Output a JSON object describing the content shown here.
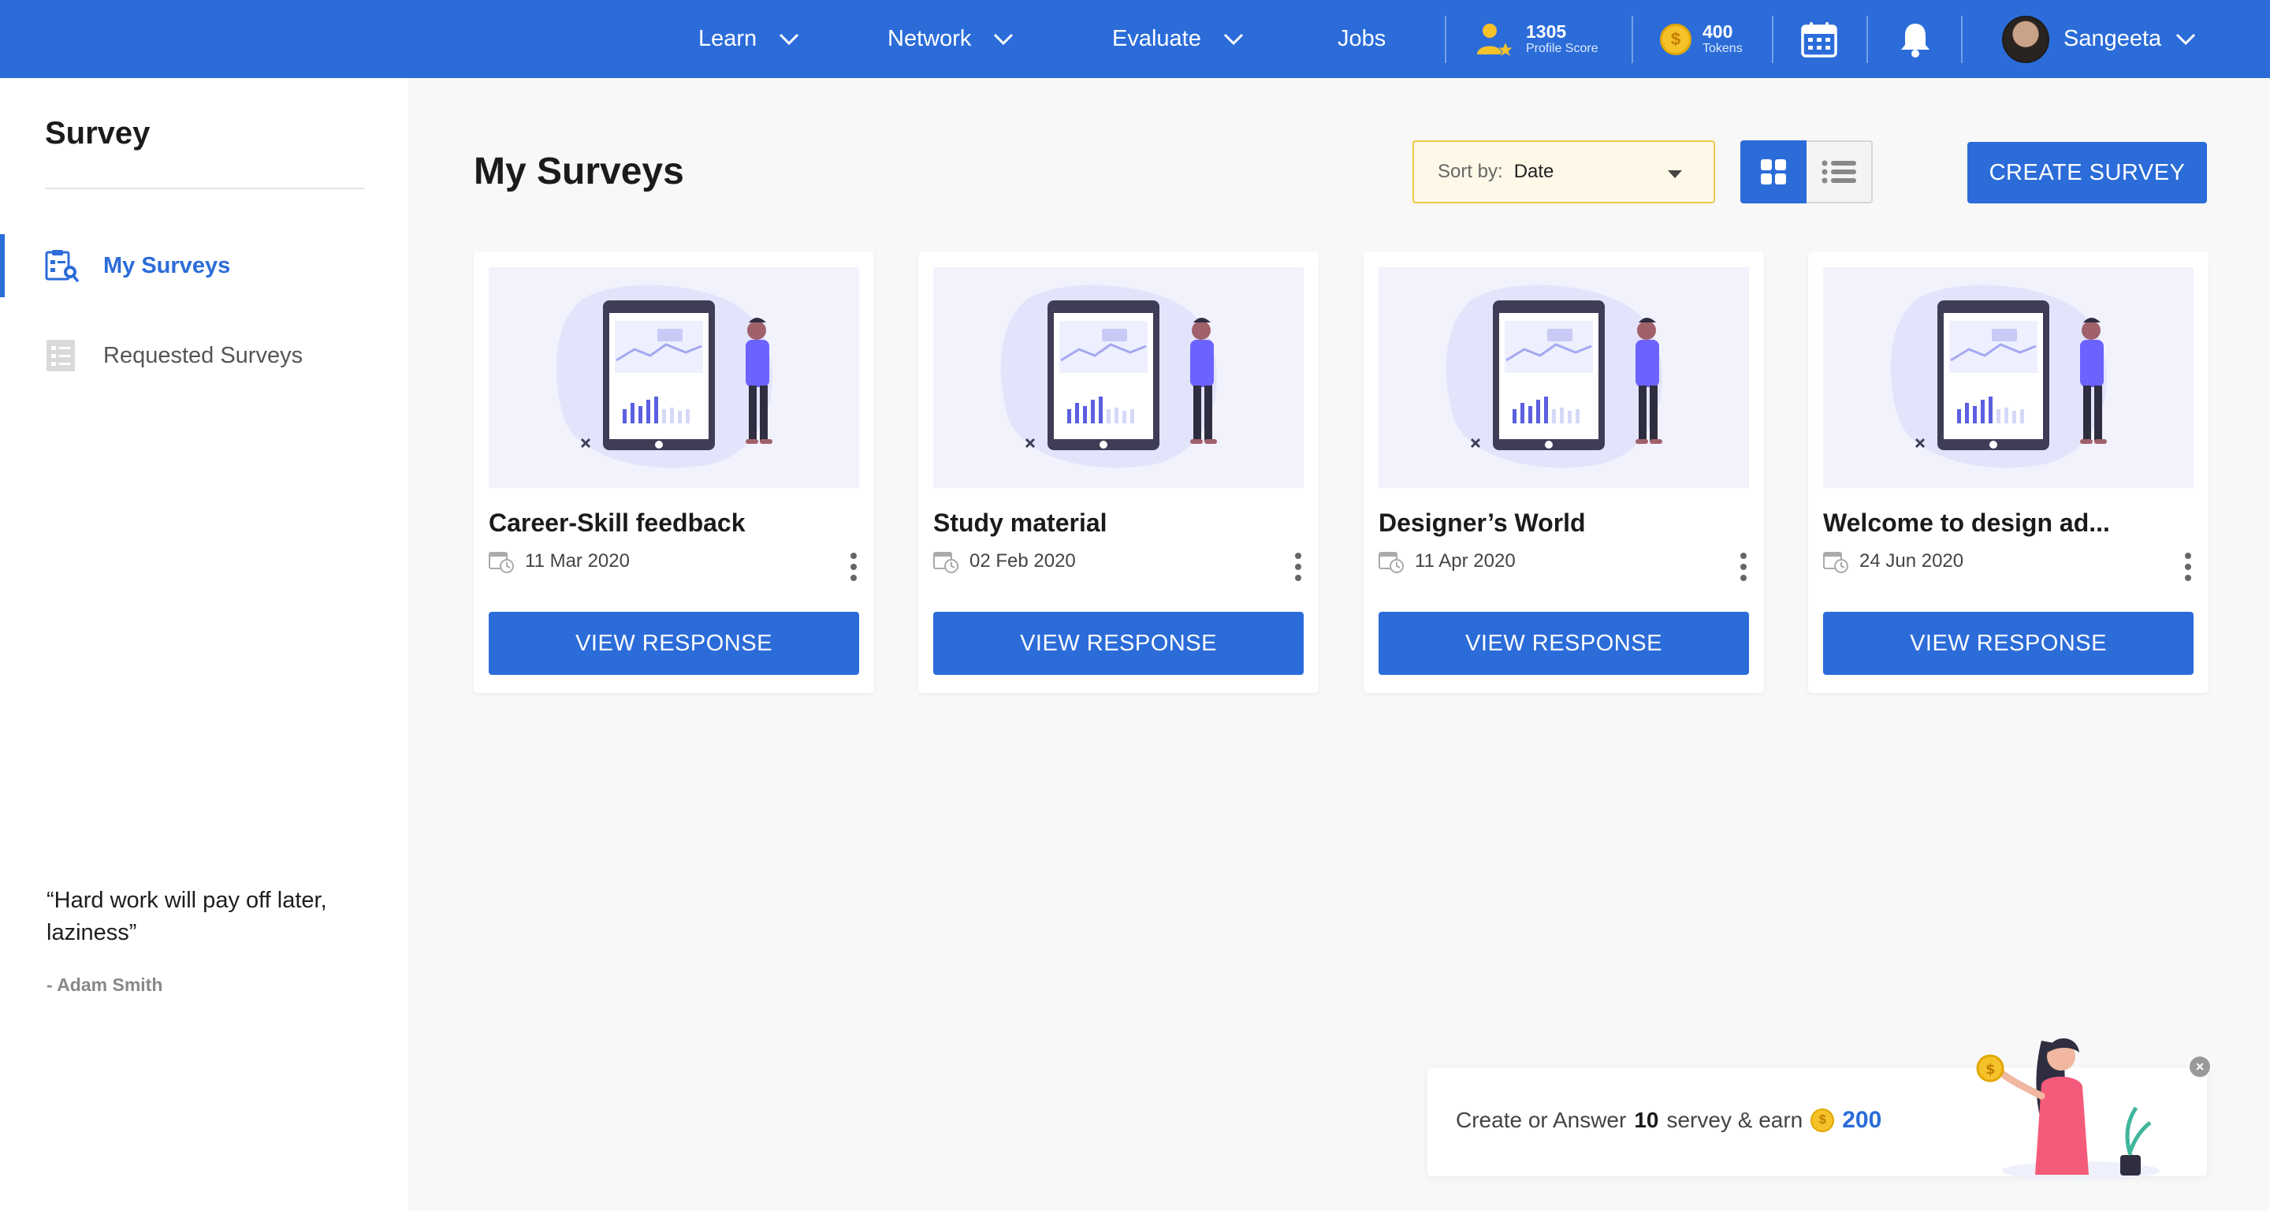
{
  "nav": {
    "items": [
      {
        "label": "Learn"
      },
      {
        "label": "Network"
      },
      {
        "label": "Evaluate"
      },
      {
        "label": "Jobs"
      }
    ],
    "profile_score": {
      "value": "1305",
      "label": "Profile Score"
    },
    "tokens": {
      "value": "400",
      "label": "Tokens",
      "coin_symbol": "$"
    },
    "user": {
      "name": "Sangeeta"
    },
    "icons": [
      "profile-score-icon",
      "coin-icon",
      "calendar-icon",
      "bell-icon",
      "chevron-down-icon"
    ]
  },
  "sidebar": {
    "title": "Survey",
    "items": [
      {
        "label": "My Surveys",
        "icon": "survey-search-icon",
        "active": true
      },
      {
        "label": "Requested Surveys",
        "icon": "survey-list-icon",
        "active": false
      }
    ],
    "quote": {
      "text": "“Hard work will pay off later, laziness”",
      "author": "- Adam Smith"
    }
  },
  "main": {
    "title": "My Surveys",
    "sort": {
      "label": "Sort by:",
      "value": "Date"
    },
    "view": {
      "selected": "grid"
    },
    "create_label": "CREATE SURVEY",
    "cards": [
      {
        "title": "Career-Skill feedback",
        "date": "11 Mar 2020",
        "button": "VIEW RESPONSE"
      },
      {
        "title": "Study material",
        "date": "02 Feb 2020",
        "button": "VIEW RESPONSE"
      },
      {
        "title": "Designer’s World",
        "date": "11 Apr 2020",
        "button": "VIEW RESPONSE"
      },
      {
        "title": "Welcome to design ad...",
        "date": "24 Jun 2020",
        "button": "VIEW RESPONSE"
      }
    ]
  },
  "promo": {
    "text_prefix": "Create or Answer",
    "count": "10",
    "text_suffix": "servey & earn",
    "coin_symbol": "$",
    "amount": "200",
    "close_symbol": "×"
  },
  "colors": {
    "primary": "#2b6cd9",
    "accent_yellow": "#f0c94a",
    "coin": "#f6c22a"
  }
}
